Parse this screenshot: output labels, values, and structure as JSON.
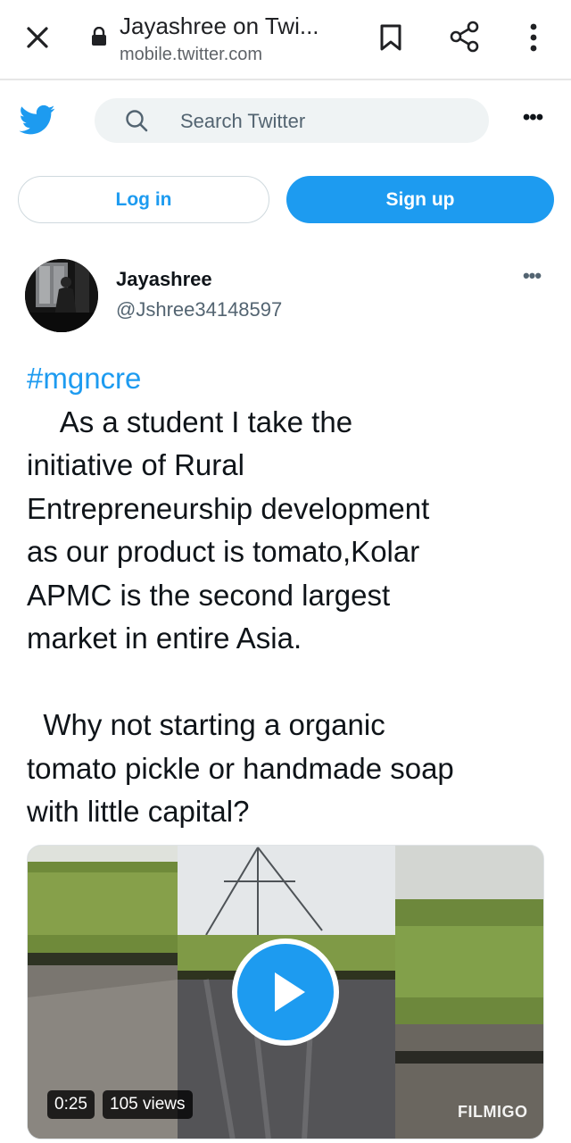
{
  "browser": {
    "title": "Jayashree on Twi...",
    "url": "mobile.twitter.com",
    "icons": [
      "close-icon",
      "lock-icon",
      "bookmark-icon",
      "share-icon",
      "more-vertical-icon"
    ]
  },
  "header": {
    "search_placeholder": "Search Twitter",
    "more_label": "•••",
    "login_label": "Log in",
    "signup_label": "Sign up",
    "accent": "#1d9bf0"
  },
  "tweet": {
    "name": "Jayashree",
    "handle": "@Jshree34148597",
    "more_label": "•••",
    "hashtag": "#mgncre",
    "text": "\n    As a student I take the\ninitiative of Rural\nEntrepreneurship development\nas our product is tomato,Kolar\nAPMC is the second largest\nmarket in entire Asia.\n\n  Why not starting a organic\ntomato pickle or handmade soap\nwith little capital?"
  },
  "media": {
    "duration": "0:25",
    "views": "105 views",
    "watermark": "FILMIGO"
  }
}
